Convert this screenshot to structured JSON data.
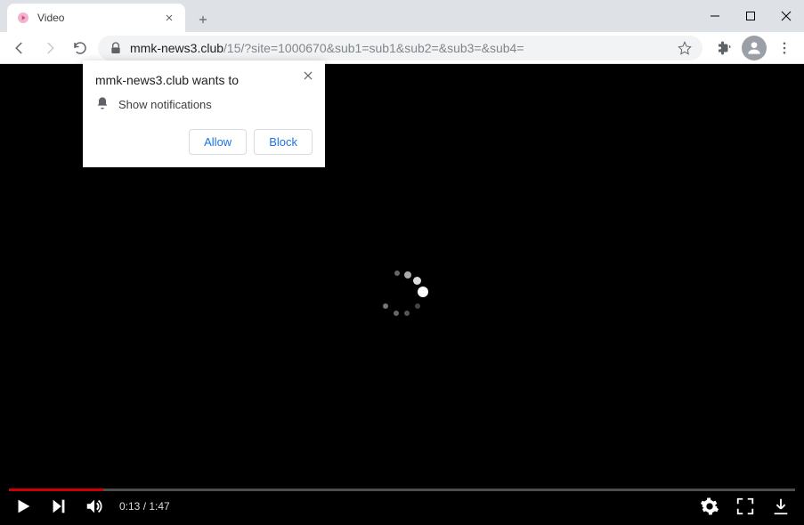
{
  "window": {
    "tab_title": "Video"
  },
  "toolbar": {
    "url_host": "mmk-news3.club",
    "url_path": "/15/?site=1000670&sub1=sub1&sub2=&sub3=&sub4="
  },
  "permission": {
    "title_prefix": "mmk-news3.club",
    "title_suffix": " wants to",
    "request_text": "Show notifications",
    "allow_label": "Allow",
    "block_label": "Block"
  },
  "video": {
    "current_time": "0:13",
    "duration": "1:47",
    "progress_percent": 12
  }
}
